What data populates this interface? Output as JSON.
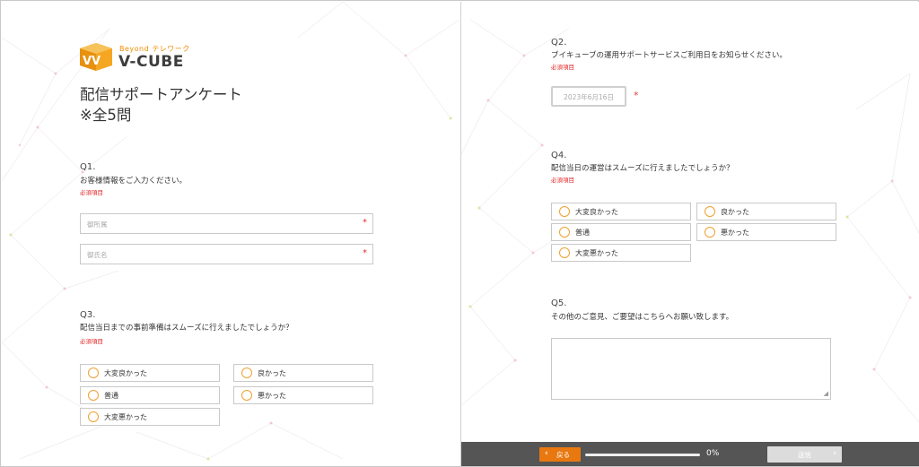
{
  "logo": {
    "tagline": "Beyond テレワーク",
    "wordmark": "V-CUBE"
  },
  "survey": {
    "title_line1": "配信サポートアンケート",
    "title_line2": "※全5問"
  },
  "q1": {
    "num": "Q1.",
    "text": "お客様情報をご入力ください。",
    "required": "必須項目",
    "fields": [
      {
        "placeholder": "御所属",
        "star": "*"
      },
      {
        "placeholder": "御氏名",
        "star": "*"
      }
    ]
  },
  "q3": {
    "num": "Q3.",
    "text": "配信当日までの事前準備はスムーズに行えましたでしょうか？",
    "required": "必須項目",
    "options": [
      "大変良かった",
      "良かった",
      "普通",
      "悪かった",
      "大変悪かった"
    ]
  },
  "q2": {
    "num": "Q2.",
    "text": "ブイキューブの運用サポートサービスご利用日をお知らせください。",
    "required": "必須項目",
    "date_placeholder": "2023年6月16日",
    "star": "*"
  },
  "q4": {
    "num": "Q4.",
    "text": "配信当日の運営はスムーズに行えましたでしょうか？",
    "required": "必須項目",
    "options": [
      "大変良かった",
      "良かった",
      "普通",
      "悪かった",
      "大変悪かった"
    ]
  },
  "q5": {
    "num": "Q5.",
    "text": "その他のご意見、ご要望はこちらへお願い致します。",
    "resize_grip": "◢"
  },
  "footer": {
    "back_label": "戻る",
    "back_chevron": "‹",
    "progress_percent": 0,
    "progress_text": "0%",
    "send_label": "送信",
    "send_chevron": "›"
  },
  "colors": {
    "accent": "#e8780f",
    "radio": "#f0a030",
    "required": "#e02020",
    "footer_bg": "#555555"
  }
}
